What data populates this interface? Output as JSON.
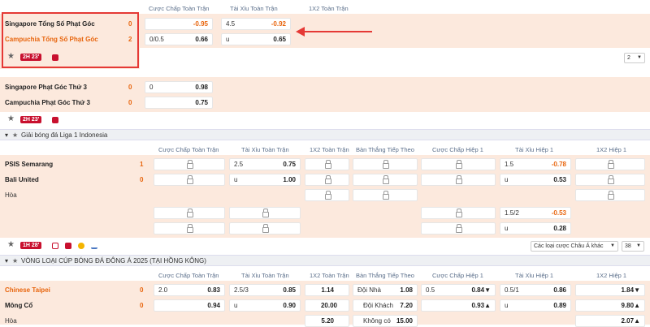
{
  "colors": {
    "accent": "#e8650d",
    "live_red": "#c8102e",
    "highlight_bg": "#fce9dd",
    "box_red": "#e53935"
  },
  "section1": {
    "headers": [
      "Cược Chấp Toàn Trận",
      "Tài Xỉu Toàn Trận",
      "1X2 Toàn Trận"
    ],
    "home": {
      "name": "Singapore Tổng Số Phạt Góc",
      "score": "0"
    },
    "away": {
      "name": "Campuchia Tổng Số Phạt Góc",
      "score": "2"
    },
    "row1": {
      "hcap_l": "",
      "hcap_r": "-0.95",
      "ou_l": "4.5",
      "ou_r": "-0.92"
    },
    "row2": {
      "hcap_l": "0/0.5",
      "hcap_r": "0.66",
      "ou_l": "u",
      "ou_r": "0.65"
    },
    "live": "2H 23'",
    "select": "2"
  },
  "section2": {
    "home": {
      "name": "Singapore Phạt Góc Thứ 3",
      "score": "0"
    },
    "away": {
      "name": "Campuchia Phạt Góc Thứ 3",
      "score": "0"
    },
    "row1": {
      "l": "0",
      "r": "0.98"
    },
    "row2": {
      "l": "",
      "r": "0.75"
    },
    "live": "2H 23'"
  },
  "league1": {
    "name": "Giải bóng đá Liga 1 Indonesia"
  },
  "match1": {
    "headers": [
      "Cược Chấp Toàn Trận",
      "Tài Xỉu Toàn Trận",
      "1X2 Toàn Trận",
      "Bàn Thắng Tiếp Theo",
      "Cược Chấp Hiệp 1",
      "Tài Xỉu Hiệp 1",
      "1X2 Hiệp 1"
    ],
    "home": {
      "name": "PSIS Semarang",
      "score": "1"
    },
    "away": {
      "name": "Bali United",
      "score": "0"
    },
    "draw": "Hòa",
    "ou_r1_l": "2.5",
    "ou_r1_r": "0.75",
    "ou_r2_l": "u",
    "ou_r2_r": "1.00",
    "h1ou_r1_l": "1.5",
    "h1ou_r1_r": "-0.78",
    "h1ou_r2_l": "u",
    "h1ou_r2_r": "0.53",
    "h1ou_r3_l": "1.5/2",
    "h1ou_r3_r": "-0.53",
    "h1ou_r4_l": "u",
    "h1ou_r4_r": "0.28",
    "live": "1H 28'",
    "type_select": "Các loại cược Châu Á khác",
    "count_select": "38"
  },
  "league2": {
    "name": "VÒNG LOẠI CÚP BÓNG ĐÁ ĐÔNG Á 2025 (TẠI HỒNG KÔNG)"
  },
  "match2": {
    "headers": [
      "Cược Chấp Toàn Trận",
      "Tài Xỉu Toàn Trận",
      "1X2 Toàn Trận",
      "Bàn Thắng Tiếp Theo",
      "Cược Chấp Hiệp 1",
      "Tài Xỉu Hiệp 1",
      "1X2 Hiệp 1"
    ],
    "home": {
      "name": "Chinese Taipei",
      "score": "0"
    },
    "away": {
      "name": "Mông Cổ",
      "score": "0"
    },
    "draw": "Hòa",
    "r1": {
      "hc_l": "2.0",
      "hc_r": "0.83",
      "ou_l": "2.5/3",
      "ou_r": "0.85",
      "x12": "1.14",
      "next_l": "Đội Nhà",
      "next_r": "1.08",
      "h1hc_l": "0.5",
      "h1hc_r": "0.84▼",
      "h1ou_l": "0.5/1",
      "h1ou_r": "0.86",
      "h1x": "1.84▼"
    },
    "r2": {
      "hc_r": "0.94",
      "ou_l": "u",
      "ou_r": "0.90",
      "x12": "20.00",
      "next_l": "Đội Khách",
      "next_r": "7.20",
      "h1hc_r": "0.93▲",
      "h1ou_l": "u",
      "h1ou_r": "0.89",
      "h1x": "9.80▲"
    },
    "r3": {
      "x12": "5.20",
      "next_l": "Không có",
      "next_r": "15.00",
      "h1x": "2.07▲"
    }
  }
}
